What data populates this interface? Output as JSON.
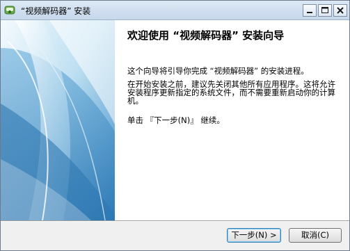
{
  "window": {
    "title": "“视频解码器” 安装",
    "icon": "installer-app-icon",
    "controls": {
      "minimize": "minimize-icon",
      "maximize": "maximize-icon",
      "close": "close-icon"
    }
  },
  "wizard": {
    "heading": "欢迎使用 “视频解码器” 安装向导",
    "paragraph1": "这个向导将引导你完成 “视频解码器” 的安装进程。",
    "paragraph2": "在开始安装之前，建议先关闭其他所有应用程序。这将允许安装程序更新指定的系统文件，而不需要重新启动你的计算机。",
    "paragraph3": "单击 『下一步(N)』 继续。"
  },
  "buttons": {
    "next_label": "下一步(N) >",
    "cancel_label": "取消(C)"
  },
  "colors": {
    "banner_light": "#e8f4fb",
    "banner_mid": "#7fbcdf",
    "banner_dark": "#2f7bb5",
    "titlebar": "#cfdff0"
  }
}
